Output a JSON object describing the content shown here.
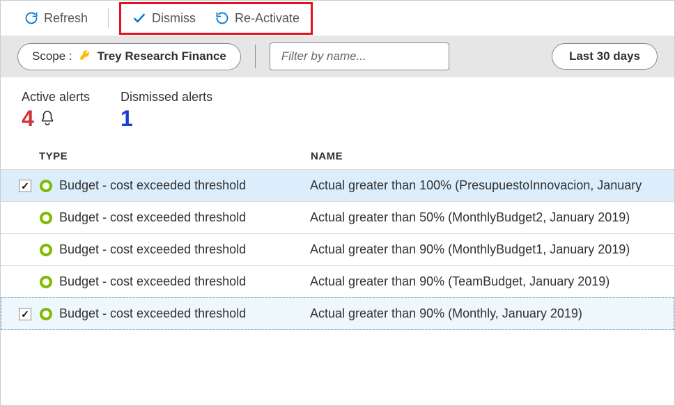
{
  "toolbar": {
    "refresh_label": "Refresh",
    "dismiss_label": "Dismiss",
    "reactivate_label": "Re-Activate"
  },
  "filter": {
    "scope_label": "Scope :",
    "scope_value": "Trey Research Finance",
    "filter_placeholder": "Filter by name...",
    "date_range_label": "Last 30 days"
  },
  "summary": {
    "active_label": "Active alerts",
    "active_count": "4",
    "dismissed_label": "Dismissed alerts",
    "dismissed_count": "1"
  },
  "table": {
    "head_type": "TYPE",
    "head_name": "NAME",
    "rows": [
      {
        "checked": true,
        "state": "selected",
        "type": "Budget - cost exceeded threshold",
        "name": "Actual greater than 100% (PresupuestoInnovacion, January "
      },
      {
        "checked": false,
        "state": "",
        "type": "Budget - cost exceeded threshold",
        "name": "Actual greater than 50% (MonthlyBudget2, January 2019)"
      },
      {
        "checked": false,
        "state": "",
        "type": "Budget - cost exceeded threshold",
        "name": "Actual greater than 90% (MonthlyBudget1, January 2019)"
      },
      {
        "checked": false,
        "state": "",
        "type": "Budget - cost exceeded threshold",
        "name": "Actual greater than 90% (TeamBudget, January 2019)"
      },
      {
        "checked": true,
        "state": "focused",
        "type": "Budget - cost exceeded threshold",
        "name": "Actual greater than 90% (Monthly, January 2019)"
      }
    ]
  }
}
